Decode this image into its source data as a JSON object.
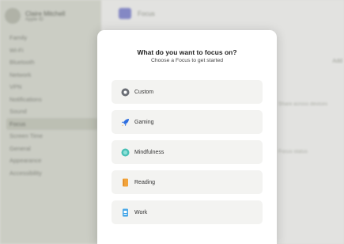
{
  "sidebar": {
    "account_name": "Claire Mitchell",
    "account_sub": "Apple ID",
    "items": [
      {
        "label": "Family"
      },
      {
        "label": "Wi-Fi"
      },
      {
        "label": "Bluetooth"
      },
      {
        "label": "Network"
      },
      {
        "label": "VPN"
      },
      {
        "label": "Notifications"
      },
      {
        "label": "Sound"
      },
      {
        "label": "Focus",
        "active": true
      },
      {
        "label": "Screen Time"
      },
      {
        "label": "General"
      },
      {
        "label": "Appearance"
      },
      {
        "label": "Accessibility"
      }
    ]
  },
  "content": {
    "title": "Focus",
    "right_label": "Add",
    "row_text_1": "Share across devices",
    "row_text_2": "Focus status"
  },
  "modal": {
    "title": "What do you want to focus on?",
    "subtitle": "Choose a Focus to get started",
    "items": [
      {
        "label": "Custom",
        "icon": "custom-icon",
        "color": "#6b6e75"
      },
      {
        "label": "Gaming",
        "icon": "rocket-icon",
        "color": "#2f6fe0"
      },
      {
        "label": "Mindfulness",
        "icon": "mindfulness-icon",
        "color": "#49c0b6"
      },
      {
        "label": "Reading",
        "icon": "book-icon",
        "color": "#f2a33a"
      },
      {
        "label": "Work",
        "icon": "badge-icon",
        "color": "#4aa8e8"
      }
    ]
  }
}
